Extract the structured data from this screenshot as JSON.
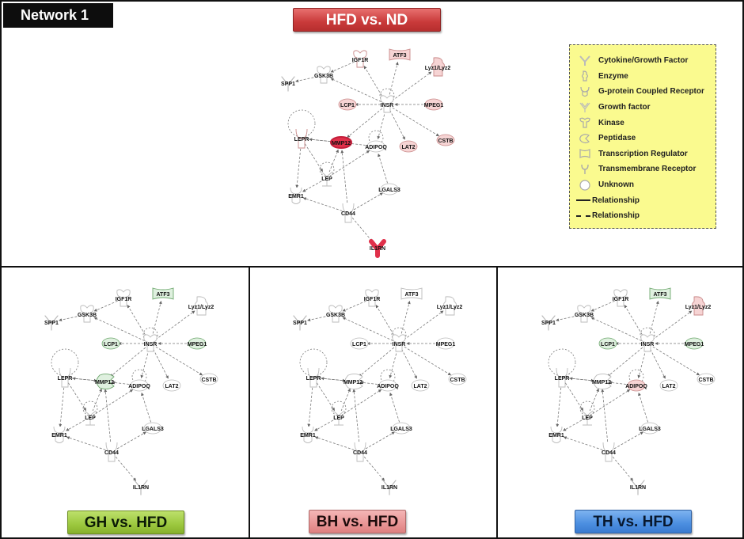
{
  "figure": {
    "network_label": "Network 1",
    "panels": [
      {
        "id": "top",
        "comparison": "HFD vs. ND",
        "badge_color": "#c94040",
        "highlights": {
          "ATF3": "up-light",
          "MMP12": "up-strong",
          "IL1RN": "up-strong",
          "LAT2": "up-light",
          "Lyz1/Lyz2": "up-light",
          "LCP1": "up-light",
          "MPEG1": "up-light",
          "CSTB": "up-light",
          "IGF1R": "neutral",
          "LEPR": "neutral"
        }
      },
      {
        "id": "gh",
        "comparison": "GH vs. HFD",
        "badge_color": "#9cc83e",
        "highlights": {
          "ATF3": "down-light",
          "MMP12": "down-light",
          "LCP1": "down-light",
          "MPEG1": "down-light"
        }
      },
      {
        "id": "bh",
        "comparison": "BH vs. HFD",
        "badge_color": "#e99595",
        "highlights": {}
      },
      {
        "id": "th",
        "comparison": "TH vs. HFD",
        "badge_color": "#4b8ee0",
        "highlights": {
          "ATF3": "down-light",
          "LCP1": "down-light",
          "MPEG1": "down-light",
          "ADIPOQ": "up-light",
          "Lyz1/Lyz2": "up-light"
        }
      }
    ]
  },
  "network": {
    "nodes": [
      {
        "id": "IGF1R",
        "label": "IGF1R",
        "type": "kinase"
      },
      {
        "id": "ATF3",
        "label": "ATF3",
        "type": "transcription-regulator"
      },
      {
        "id": "Lyz1/Lyz2",
        "label": "Lyz1/Lyz2",
        "type": "enzyme"
      },
      {
        "id": "GSK3B",
        "label": "GSK3B",
        "type": "kinase"
      },
      {
        "id": "SPP1",
        "label": "SPP1",
        "type": "cytokine"
      },
      {
        "id": "INSR",
        "label": "INSR",
        "type": "kinase"
      },
      {
        "id": "LCP1",
        "label": "LCP1",
        "type": "unknown"
      },
      {
        "id": "MPEG1",
        "label": "MPEG1",
        "type": "unknown"
      },
      {
        "id": "LEPR",
        "label": "LEPR",
        "type": "transmembrane-receptor"
      },
      {
        "id": "MMP12",
        "label": "MMP12",
        "type": "peptidase"
      },
      {
        "id": "ADIPOQ",
        "label": "ADIPOQ",
        "type": "unknown"
      },
      {
        "id": "LAT2",
        "label": "LAT2",
        "type": "unknown"
      },
      {
        "id": "CSTB",
        "label": "CSTB",
        "type": "unknown"
      },
      {
        "id": "LEP",
        "label": "LEP",
        "type": "growth-factor"
      },
      {
        "id": "EMR1",
        "label": "EMR1",
        "type": "g-protein-coupled-receptor"
      },
      {
        "id": "LGALS3",
        "label": "LGALS3",
        "type": "unknown"
      },
      {
        "id": "CD44",
        "label": "CD44",
        "type": "transmembrane-receptor"
      },
      {
        "id": "IL1RN",
        "label": "IL1RN",
        "type": "cytokine"
      }
    ],
    "edges": [
      {
        "from": "IGF1R",
        "to": "GSK3B"
      },
      {
        "from": "GSK3B",
        "to": "SPP1"
      },
      {
        "from": "INSR",
        "to": "GSK3B"
      },
      {
        "from": "INSR",
        "to": "IGF1R"
      },
      {
        "from": "INSR",
        "to": "ATF3"
      },
      {
        "from": "INSR",
        "to": "Lyz1/Lyz2"
      },
      {
        "from": "INSR",
        "to": "LCP1"
      },
      {
        "from": "MPEG1",
        "to": "INSR"
      },
      {
        "from": "INSR",
        "to": "CSTB"
      },
      {
        "from": "INSR",
        "to": "LAT2"
      },
      {
        "from": "INSR",
        "to": "ADIPOQ"
      },
      {
        "from": "INSR",
        "to": "MMP12"
      },
      {
        "from": "LEPR",
        "to": "MMP12"
      },
      {
        "from": "MMP12",
        "to": "LEPR"
      },
      {
        "from": "ADIPOQ",
        "to": "MMP12"
      },
      {
        "from": "LEPR",
        "to": "LEP"
      },
      {
        "from": "LEPR",
        "to": "EMR1"
      },
      {
        "from": "LEP",
        "to": "MMP12"
      },
      {
        "from": "LEP",
        "to": "ADIPOQ"
      },
      {
        "from": "LEP",
        "to": "EMR1"
      },
      {
        "from": "CD44",
        "to": "EMR1"
      },
      {
        "from": "CD44",
        "to": "MMP12"
      },
      {
        "from": "CD44",
        "to": "LGALS3"
      },
      {
        "from": "LGALS3",
        "to": "ADIPOQ"
      },
      {
        "from": "CD44",
        "to": "IL1RN"
      }
    ],
    "self_loops": [
      "INSR",
      "ADIPOQ",
      "LEPR",
      "LEP"
    ]
  },
  "legend": {
    "items": [
      {
        "shape": "cytokine",
        "label": "Cytokine/Growth Factor"
      },
      {
        "shape": "enzyme",
        "label": "Enzyme"
      },
      {
        "shape": "g-protein-coupled-receptor",
        "label": "G-protein Coupled Receptor"
      },
      {
        "shape": "growth-factor",
        "label": "Growth factor"
      },
      {
        "shape": "kinase",
        "label": "Kinase"
      },
      {
        "shape": "peptidase",
        "label": "Peptidase"
      },
      {
        "shape": "transcription-regulator",
        "label": "Transcription Regulator"
      },
      {
        "shape": "transmembrane-receptor",
        "label": "Transmembrane Receptor"
      },
      {
        "shape": "unknown",
        "label": "Unknown"
      }
    ],
    "lines": [
      {
        "style": "solid",
        "label": "Relationship"
      },
      {
        "style": "dashed",
        "label": "Relationship"
      }
    ]
  },
  "colors": {
    "up-strong": "#e0304a",
    "up-light": "#f6d4d4",
    "down-light": "#dff0df",
    "neutral": "#ffffff",
    "edge": "#7a7a7a"
  }
}
